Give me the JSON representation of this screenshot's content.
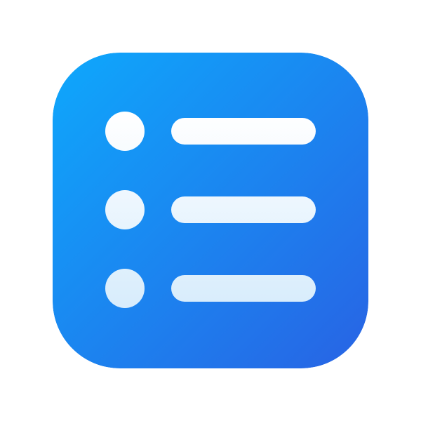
{
  "icon": {
    "name": "list-icon",
    "item_count": 3,
    "colors": {
      "gradient_start": "#0EA8FC",
      "gradient_end": "#2863E4",
      "glyph_top": "#FFFFFF",
      "glyph_bottom": "#D7ECFC",
      "page_background": "#FFFFFF"
    }
  }
}
